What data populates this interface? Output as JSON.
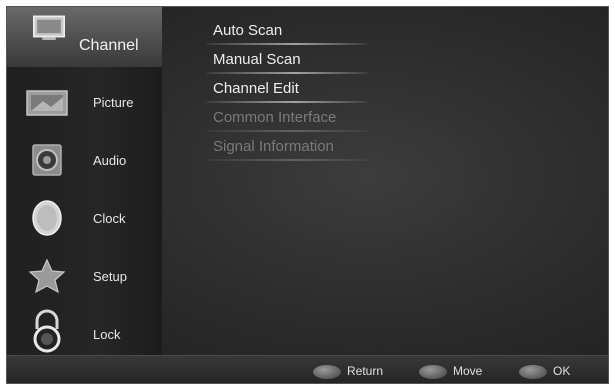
{
  "sidebar": {
    "items": [
      {
        "label": "Channel",
        "icon": "tv-channel-icon",
        "active": true
      },
      {
        "label": "Picture",
        "icon": "picture-icon"
      },
      {
        "label": "Audio",
        "icon": "speaker-icon"
      },
      {
        "label": "Clock",
        "icon": "clock-icon"
      },
      {
        "label": "Setup",
        "icon": "star-setup-icon"
      },
      {
        "label": "Lock",
        "icon": "padlock-icon"
      }
    ]
  },
  "submenu": {
    "options": [
      {
        "label": "Auto Scan",
        "enabled": true
      },
      {
        "label": "Manual Scan",
        "enabled": true
      },
      {
        "label": "Channel Edit",
        "enabled": true
      },
      {
        "label": "Common Interface",
        "enabled": false
      },
      {
        "label": "Signal Information",
        "enabled": false
      }
    ]
  },
  "footer": {
    "return_label": "Return",
    "move_label": "Move",
    "ok_label": "OK"
  }
}
